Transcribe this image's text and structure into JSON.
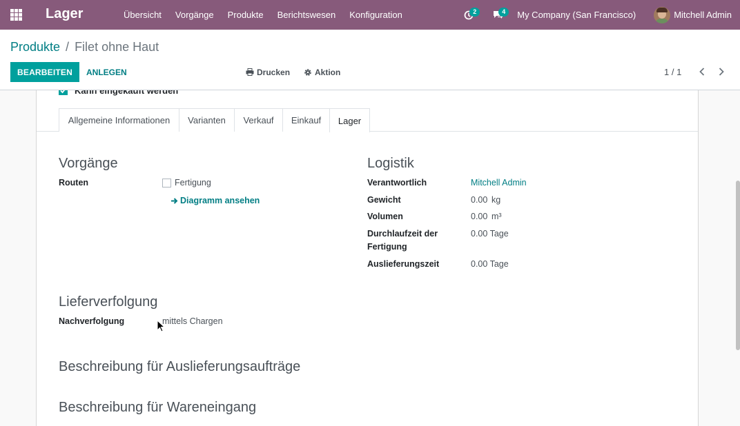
{
  "navbar": {
    "app_name": "Lager",
    "menu": [
      "Übersicht",
      "Vorgänge",
      "Produkte",
      "Berichtswesen",
      "Konfiguration"
    ],
    "activity_count": "2",
    "message_count": "4",
    "company": "My Company (San Francisco)",
    "user": "Mitchell Admin",
    "bg_color": "#875a7b"
  },
  "control_panel": {
    "breadcrumb_parent": "Produkte",
    "breadcrumb_separator": "/",
    "breadcrumb_current": "Filet ohne Haut",
    "edit_label": "BEARBEITEN",
    "create_label": "ANLEGEN",
    "print_label": "Drucken",
    "action_label": "Aktion",
    "pager": "1 / 1"
  },
  "form": {
    "purchase_ok_label": "Kann eingekauft werden",
    "tabs": [
      "Allgemeine Informationen",
      "Varianten",
      "Verkauf",
      "Einkauf",
      "Lager"
    ],
    "active_tab": "Lager",
    "operations": {
      "title": "Vorgänge",
      "routes_label": "Routen",
      "route_option": "Fertigung",
      "diagram_link": "Diagramm ansehen"
    },
    "logistics": {
      "title": "Logistik",
      "responsible_label": "Verantwortlich",
      "responsible_value": "Mitchell Admin",
      "weight_label": "Gewicht",
      "weight_value": "0.00",
      "weight_unit": "kg",
      "volume_label": "Volumen",
      "volume_value": "0.00",
      "volume_unit": "m³",
      "mfg_lead_label_1": "Durchlaufzeit der",
      "mfg_lead_label_2": "Fertigung",
      "mfg_lead_value": "0.00 Tage",
      "delivery_lead_label": "Auslieferungszeit",
      "delivery_lead_value": "0.00 Tage"
    },
    "traceability": {
      "title": "Lieferverfolgung",
      "tracking_label": "Nachverfolgung",
      "tracking_value": "mittels Chargen"
    },
    "desc_delivery_title": "Beschreibung für Auslieferungsaufträge",
    "desc_receipt_title": "Beschreibung für Wareneingang"
  },
  "icons": [
    "apps-icon",
    "activity-clock-icon",
    "chat-icon",
    "print-icon",
    "gear-icon",
    "chevron-left-icon",
    "chevron-right-icon",
    "arrow-right-icon",
    "checkbox-icon",
    "mouse-cursor-icon"
  ]
}
